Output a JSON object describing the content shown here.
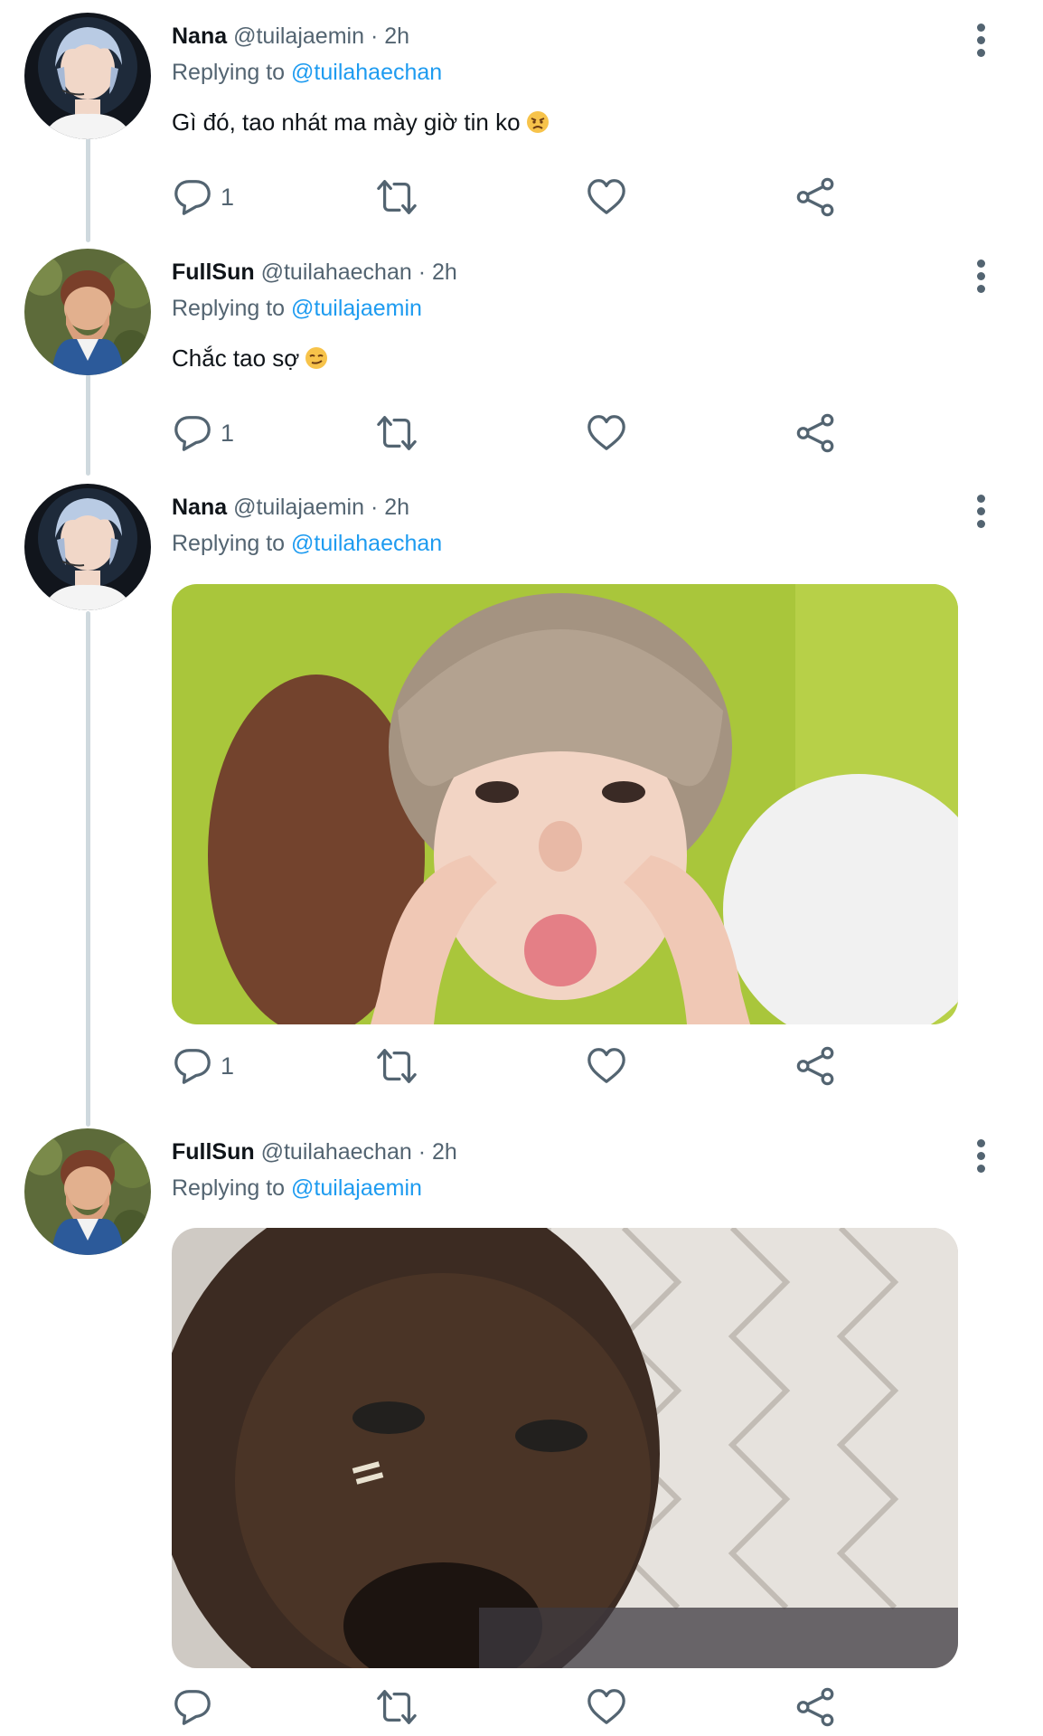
{
  "colors": {
    "accent": "#1d9bf0",
    "secondary_text": "#536471",
    "thread_line": "#cfd9de"
  },
  "tweets": [
    {
      "name": "Nana",
      "handle": "@tuilajaemin",
      "time": "· 2h",
      "replying_label": "Replying to",
      "replying_to": "@tuilahaechan",
      "text": "Gì đó, tao nhát ma mày giờ tin ko",
      "emoji": "angry-face-emoji",
      "reply_count": "1",
      "avatar": "silver-hair-avatar"
    },
    {
      "name": "FullSun",
      "handle": "@tuilahaechan",
      "time": "· 2h",
      "replying_label": "Replying to",
      "replying_to": "@tuilajaemin",
      "text": "Chắc tao sợ",
      "emoji": "smirking-face-emoji",
      "reply_count": "1",
      "avatar": "hands-on-face-avatar"
    },
    {
      "name": "Nana",
      "handle": "@tuilajaemin",
      "time": "· 2h",
      "replying_label": "Replying to",
      "replying_to": "@tuilahaechan",
      "text": "",
      "media": "funny-face-photo",
      "reply_count": "1",
      "avatar": "silver-hair-avatar"
    },
    {
      "name": "FullSun",
      "handle": "@tuilahaechan",
      "time": "· 2h",
      "replying_label": "Replying to",
      "replying_to": "@tuilajaemin",
      "text": "",
      "media": "blurry-crying-selfie-photo",
      "reply_count": "",
      "avatar": "hands-on-face-avatar"
    }
  ],
  "icons": [
    "reply-icon",
    "retweet-icon",
    "like-icon",
    "share-icon",
    "more-options-icon"
  ]
}
